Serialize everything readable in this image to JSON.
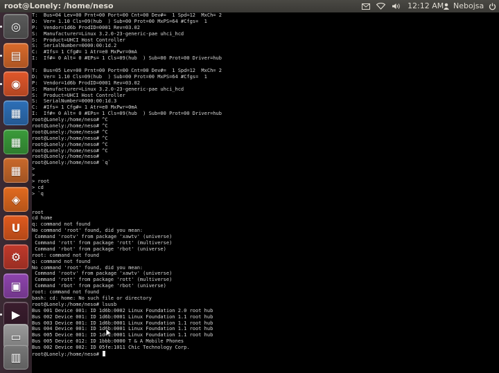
{
  "topbar": {
    "window_title": "root@Lonely: /home/neso",
    "clock": "12:12 AM",
    "username": "Nebojsa",
    "tray_icons": [
      "mail-icon",
      "wifi-icon",
      "volume-icon",
      "power-icon"
    ]
  },
  "launcher": {
    "items": [
      {
        "name": "ubuntu-dash-launcher",
        "icon": "ubuntu-logo-icon",
        "color": "#5a5a5a",
        "glyph": "◎"
      },
      {
        "name": "files-launcher",
        "icon": "folder-icon",
        "color": "#d96a2b",
        "glyph": "▤"
      },
      {
        "name": "firefox-launcher",
        "icon": "firefox-icon",
        "color": "#e0572a",
        "glyph": "◉"
      },
      {
        "name": "writer-launcher",
        "icon": "document-icon",
        "color": "#2d6fb7",
        "glyph": "▦"
      },
      {
        "name": "calc-launcher",
        "icon": "spreadsheet-icon",
        "color": "#3a9b3a",
        "glyph": "▦"
      },
      {
        "name": "impress-launcher",
        "icon": "presentation-icon",
        "color": "#c9692b",
        "glyph": "▦"
      },
      {
        "name": "software-center-launcher",
        "icon": "shopping-bag-icon",
        "color": "#e26a1f",
        "glyph": "◈"
      },
      {
        "name": "ubuntu-one-launcher",
        "icon": "ubuntu-one-icon",
        "color": "#e05a1e",
        "glyph": "U"
      },
      {
        "name": "system-settings-launcher",
        "icon": "gear-icon",
        "color": "#c0392b",
        "glyph": "⚙"
      },
      {
        "name": "workspace-switcher-launcher",
        "icon": "workspaces-icon",
        "color": "#8e44ad",
        "glyph": "▣"
      },
      {
        "name": "terminal-launcher",
        "icon": "terminal-icon",
        "color": "#3a1d2e",
        "glyph": "▶"
      },
      {
        "name": "device-launcher",
        "icon": "drive-icon",
        "color": "#9a9a9a",
        "glyph": "▭"
      },
      {
        "name": "trash-launcher",
        "icon": "trash-icon",
        "color": "#777777",
        "glyph": "▥"
      }
    ]
  },
  "terminal": {
    "lines": [
      "T:  Bus=04 Lev=00 Prnt=00 Port=00 Cnt=00 Dev#=  1 Spd=12  MxCh= 2",
      "D:  Ver= 1.10 Cls=09(hub  ) Sub=00 Prot=00 MxPS=64 #Cfgs=  1",
      "P:  Vendor=1d6b ProdID=0001 Rev=03.02",
      "S:  Manufacturer=Linux 3.2.0-23-generic-pae uhci_hcd",
      "S:  Product=UHCI Host Controller",
      "S:  SerialNumber=0000:00:1d.2",
      "C:  #Ifs= 1 Cfg#= 1 Atr=e0 MxPwr=0mA",
      "I:  If#= 0 Alt= 0 #EPs= 1 Cls=09(hub  ) Sub=00 Prot=00 Driver=hub",
      "",
      "T:  Bus=05 Lev=00 Prnt=00 Port=00 Cnt=00 Dev#=  1 Spd=12  MxCh= 2",
      "D:  Ver= 1.10 Cls=09(hub  ) Sub=00 Prot=00 MxPS=64 #Cfgs=  1",
      "P:  Vendor=1d6b ProdID=0001 Rev=03.02",
      "S:  Manufacturer=Linux 3.2.0-23-generic-pae uhci_hcd",
      "S:  Product=UHCI Host Controller",
      "S:  SerialNumber=0000:00:1d.3",
      "C:  #Ifs= 1 Cfg#= 1 Atr=e0 MxPwr=0mA",
      "I:  If#= 0 Alt= 0 #EPs= 1 Cls=09(hub  ) Sub=00 Prot=00 Driver=hub",
      "root@Lonely:/home/neso# ^C",
      "root@Lonely:/home/neso# ^C",
      "root@Lonely:/home/neso# ^C",
      "root@Lonely:/home/neso# ^C",
      "root@Lonely:/home/neso# ^C",
      "root@Lonely:/home/neso# ^C",
      "root@Lonely:/home/neso#",
      "root@Lonely:/home/neso# `q`",
      ">",
      ">",
      "> root",
      "> cd",
      "> `q",
      "",
      "",
      "root",
      "cd home",
      "q: command not found",
      "No command 'root' found, did you mean:",
      " Command 'rootv' from package 'xawtv' (universe)",
      " Command 'rott' from package 'rott' (multiverse)",
      " Command 'rbot' from package 'rbot' (universe)",
      "root: command not found",
      "q: command not found",
      "No command 'root' found, did you mean:",
      " Command 'rootv' from package 'xawtv' (universe)",
      " Command 'rott' from package 'rott' (multiverse)",
      " Command 'rbot' from package 'rbot' (universe)",
      "root: command not found",
      "bash: cd: home: No such file or directory",
      "root@Lonely:/home/neso# lsusb",
      "Bus 001 Device 001: ID 1d6b:0002 Linux Foundation 2.0 root hub",
      "Bus 002 Device 001: ID 1d6b:0001 Linux Foundation 1.1 root hub",
      "Bus 003 Device 001: ID 1d6b:0001 Linux Foundation 1.1 root hub",
      "Bus 004 Device 001: ID 1d6b:0001 Linux Foundation 1.1 root hub",
      "Bus 005 Device 001: ID 1d6b:0001 Linux Foundation 1.1 root hub",
      "Bus 005 Device 012: ID 1bbb:0000 T & A Mobile Phones",
      "Bus 002 Device 002: ID 05fe:1011 Chic Technology Corp.",
      "root@Lonely:/home/neso# "
    ]
  }
}
